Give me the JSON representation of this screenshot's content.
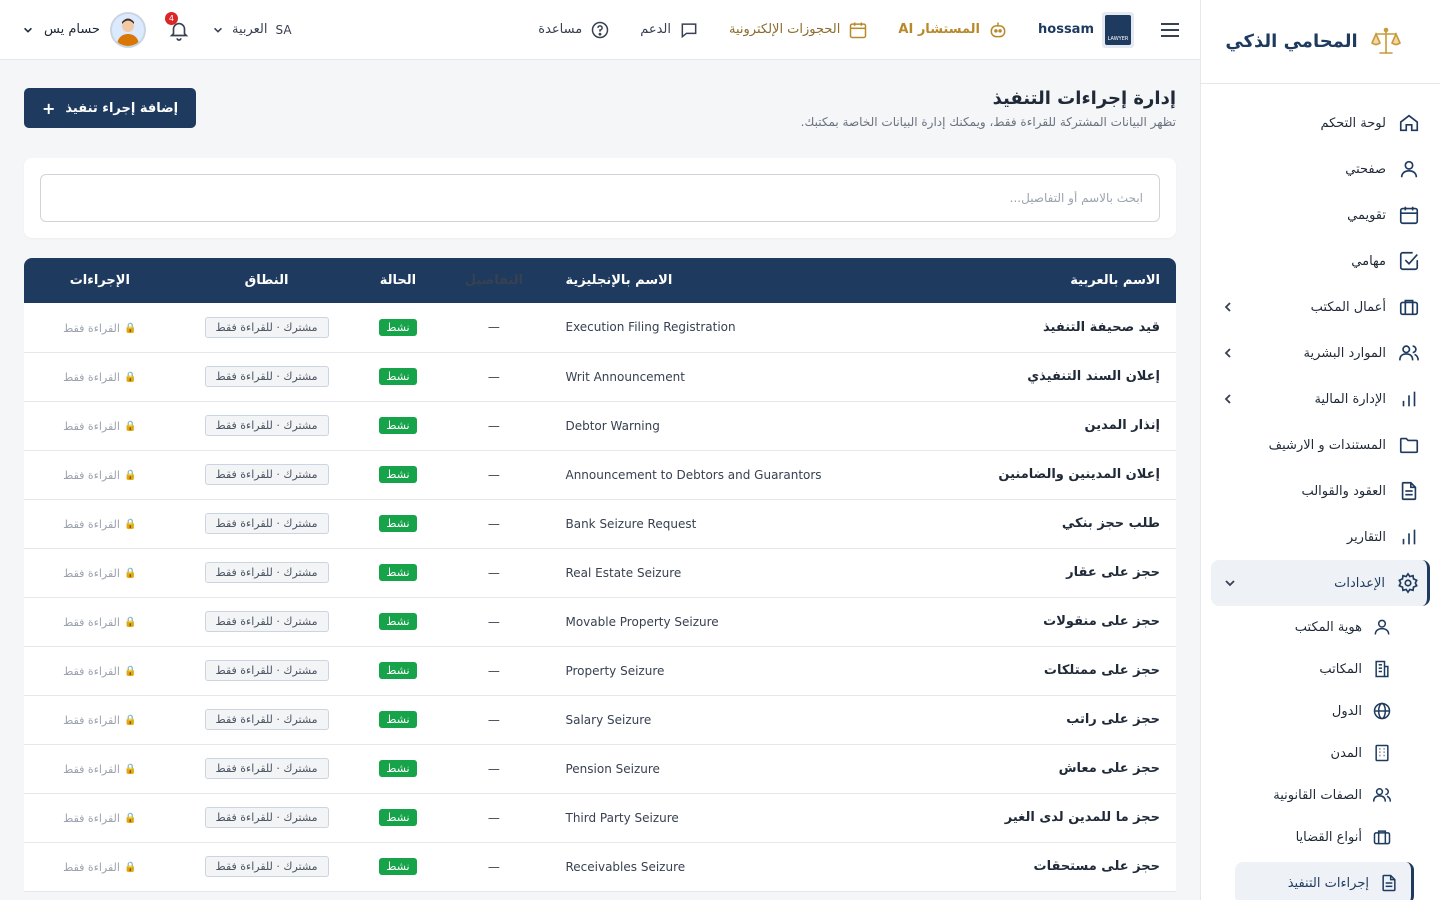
{
  "app": {
    "name": "المحامي الذكي"
  },
  "sidebar": {
    "items": [
      {
        "label": "لوحة التحكم",
        "icon": "home-icon"
      },
      {
        "label": "صفحتي",
        "icon": "user-icon"
      },
      {
        "label": "تقويمي",
        "icon": "calendar-icon"
      },
      {
        "label": "مهامي",
        "icon": "check-square-icon"
      },
      {
        "label": "أعمال المكتب",
        "icon": "briefcase-icon",
        "expandable": true
      },
      {
        "label": "الموارد البشرية",
        "icon": "users-icon",
        "expandable": true
      },
      {
        "label": "الإدارة المالية",
        "icon": "bar-chart-icon",
        "expandable": true
      },
      {
        "label": "المستندات و الارشيف",
        "icon": "folder-icon"
      },
      {
        "label": "العقود والقوالب",
        "icon": "file-text-icon"
      },
      {
        "label": "التقارير",
        "icon": "bar-chart-icon"
      }
    ],
    "settings": {
      "label": "الإعدادات",
      "icon": "gear-icon",
      "sub_items": [
        {
          "label": "هوية المكتب",
          "icon": "user-icon"
        },
        {
          "label": "المكاتب",
          "icon": "building-icon"
        },
        {
          "label": "الدول",
          "icon": "globe-icon"
        },
        {
          "label": "المدن",
          "icon": "city-icon"
        },
        {
          "label": "الصفات القانونية",
          "icon": "users-icon"
        },
        {
          "label": "أنواع القضايا",
          "icon": "briefcase-icon"
        },
        {
          "label": "إجراءات التنفيذ",
          "icon": "file-text-icon",
          "current": true
        }
      ]
    }
  },
  "header": {
    "brand_name": "hossam",
    "badge_text": "LAWYER",
    "links": {
      "ai": "المستشار AI",
      "bookings": "الحجوزات الإلكترونية",
      "support": "الدعم",
      "help": "مساعدة"
    },
    "language": {
      "code": "SA",
      "label": "العربية"
    },
    "notifications_count": "4",
    "user_name": "حسام يس"
  },
  "page": {
    "title": "إدارة إجراءات التنفيذ",
    "subtitle": "تظهر البيانات المشتركة للقراءة فقط، ويمكنك إدارة البيانات الخاصة بمكتبك.",
    "add_button": "إضافة إجراء تنفيذ",
    "search_placeholder": "ابحث بالاسم أو التفاصيل..."
  },
  "table": {
    "headers": {
      "name_ar": "الاسم بالعربية",
      "name_en": "الاسم بالإنجليزية",
      "details": "التفاصيل",
      "status": "الحالة",
      "scope": "النطاق",
      "actions": "الإجراءات"
    },
    "status_color": "#16a34a",
    "rows": [
      {
        "name_ar": "قيد صحيفة التنفيذ",
        "name_en": "Execution Filing Registration",
        "details": "—",
        "status": "نشط",
        "scope": "مشترك · للقراءة فقط",
        "action": "القراءة فقط"
      },
      {
        "name_ar": "إعلان السند التنفيذي",
        "name_en": "Writ Announcement",
        "details": "—",
        "status": "نشط",
        "scope": "مشترك · للقراءة فقط",
        "action": "القراءة فقط"
      },
      {
        "name_ar": "إنذار المدين",
        "name_en": "Debtor Warning",
        "details": "—",
        "status": "نشط",
        "scope": "مشترك · للقراءة فقط",
        "action": "القراءة فقط"
      },
      {
        "name_ar": "إعلان المدينين والضامنين",
        "name_en": "Announcement to Debtors and Guarantors",
        "details": "—",
        "status": "نشط",
        "scope": "مشترك · للقراءة فقط",
        "action": "القراءة فقط"
      },
      {
        "name_ar": "طلب حجز بنكي",
        "name_en": "Bank Seizure Request",
        "details": "—",
        "status": "نشط",
        "scope": "مشترك · للقراءة فقط",
        "action": "القراءة فقط"
      },
      {
        "name_ar": "حجز على عقار",
        "name_en": "Real Estate Seizure",
        "details": "—",
        "status": "نشط",
        "scope": "مشترك · للقراءة فقط",
        "action": "القراءة فقط"
      },
      {
        "name_ar": "حجز على منقولات",
        "name_en": "Movable Property Seizure",
        "details": "—",
        "status": "نشط",
        "scope": "مشترك · للقراءة فقط",
        "action": "القراءة فقط"
      },
      {
        "name_ar": "حجز على ممتلكات",
        "name_en": "Property Seizure",
        "details": "—",
        "status": "نشط",
        "scope": "مشترك · للقراءة فقط",
        "action": "القراءة فقط"
      },
      {
        "name_ar": "حجز على راتب",
        "name_en": "Salary Seizure",
        "details": "—",
        "status": "نشط",
        "scope": "مشترك · للقراءة فقط",
        "action": "القراءة فقط"
      },
      {
        "name_ar": "حجز على معاش",
        "name_en": "Pension Seizure",
        "details": "—",
        "status": "نشط",
        "scope": "مشترك · للقراءة فقط",
        "action": "القراءة فقط"
      },
      {
        "name_ar": "حجز ما للمدين لدى الغير",
        "name_en": "Third Party Seizure",
        "details": "—",
        "status": "نشط",
        "scope": "مشترك · للقراءة فقط",
        "action": "القراءة فقط"
      },
      {
        "name_ar": "حجز على مستحقات",
        "name_en": "Receivables Seizure",
        "details": "—",
        "status": "نشط",
        "scope": "مشترك · للقراءة فقط",
        "action": "القراءة فقط"
      }
    ]
  }
}
